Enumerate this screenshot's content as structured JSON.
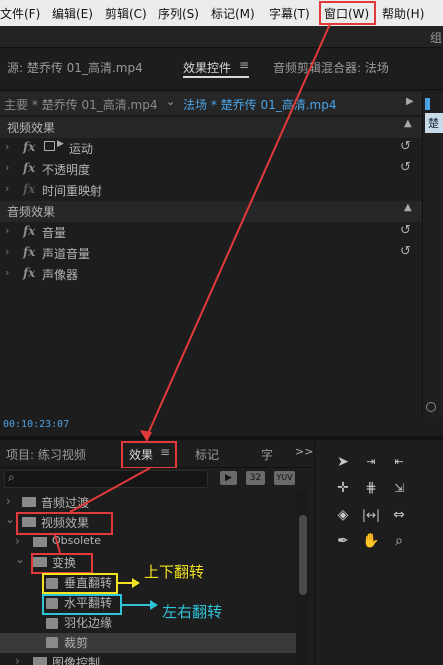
{
  "menubar": {
    "items": [
      "文件(F)",
      "编辑(E)",
      "剪辑(C)",
      "序列(S)",
      "标记(M)",
      "字幕(T)",
      "窗口(W)",
      "帮助(H)"
    ],
    "truncated_right": "组"
  },
  "source_panel": {
    "source_tab": "源: 楚乔传 01_高清.mp4",
    "effect_controls_tab": "效果控件",
    "audio_mixer_tab": "音频剪辑混合器: 法场",
    "menu_icon": "hamburger-icon"
  },
  "sequence_bar": {
    "master": "主要 * 楚乔传 01_高清.mp4",
    "sequence": "法场 * 楚乔传 01_高清.mp4",
    "right_clip_label": "楚"
  },
  "effect_controls": {
    "video_section": "视频效果",
    "video_effects": [
      "运动",
      "不透明度",
      "时间重映射"
    ],
    "audio_section": "音频效果",
    "audio_effects": [
      "音量",
      "声道音量",
      "声像器"
    ],
    "fx_symbol": "fx"
  },
  "timecode": "00:10:23:07",
  "project_panel": {
    "project_tab": "项目: 练习视频",
    "effects_tab": "效果",
    "markers_tab": "标记",
    "captions_tab": "字",
    "overflow": ">>",
    "badges": [
      "32",
      "YUV"
    ]
  },
  "effects_tree": {
    "audio_transitions": "音频过渡",
    "video_effects": "视频效果",
    "obsolete": "Obsolete",
    "transform": "变换",
    "vertical_flip": "垂直翻转",
    "horizontal_flip": "水平翻转",
    "feather_edges": "羽化边缘",
    "crop": "裁剪",
    "image_control": "图像控制"
  },
  "annotations": {
    "vertical_flip_note": "上下翻转",
    "horizontal_flip_note": "左右翻转",
    "colors": {
      "red": "#e23a3a",
      "yellow": "#f2e21f",
      "cyan": "#2fc3d8"
    }
  }
}
